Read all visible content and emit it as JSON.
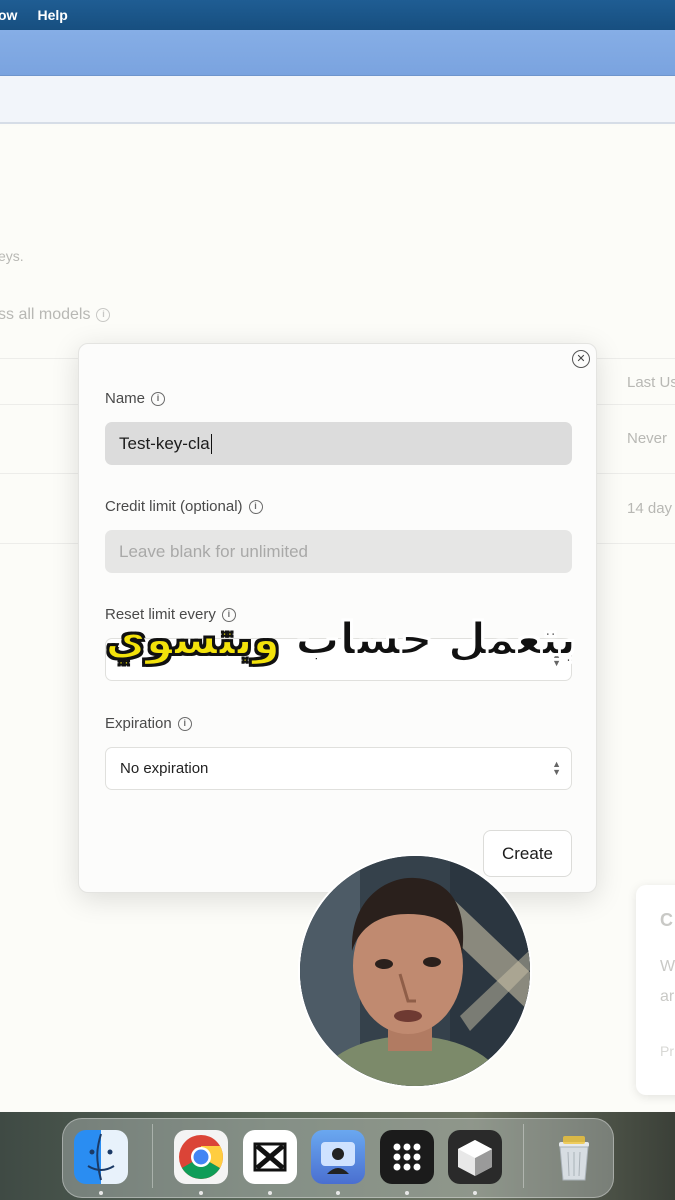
{
  "menubar": {
    "window_fragment": "ow",
    "help": "Help"
  },
  "page_bg": {
    "fragment_keys": "eys.",
    "fragment_access": "ss all models",
    "column_last_used": "Last Us",
    "row1_last_used": "Never",
    "row2_last_used": "14 day",
    "side_card": {
      "title": "C",
      "line1": "W",
      "line2": "ar",
      "line3": "Pr"
    }
  },
  "modal": {
    "name_label": "Name",
    "name_value": "Test-key-cla",
    "credit_label": "Credit limit (optional)",
    "credit_placeholder": "Leave blank for unlimited",
    "reset_label": "Reset limit every",
    "expiration_label": "Expiration",
    "expiration_value": "No expiration",
    "create_label": "Create"
  },
  "caption": {
    "part1": "بتعمل حساب ",
    "part2": "وبتسوي"
  },
  "dock": [
    "Finder",
    "Chrome",
    "CapCut",
    "Screen Recorder",
    "Launchpad",
    "App",
    "Trash"
  ]
}
